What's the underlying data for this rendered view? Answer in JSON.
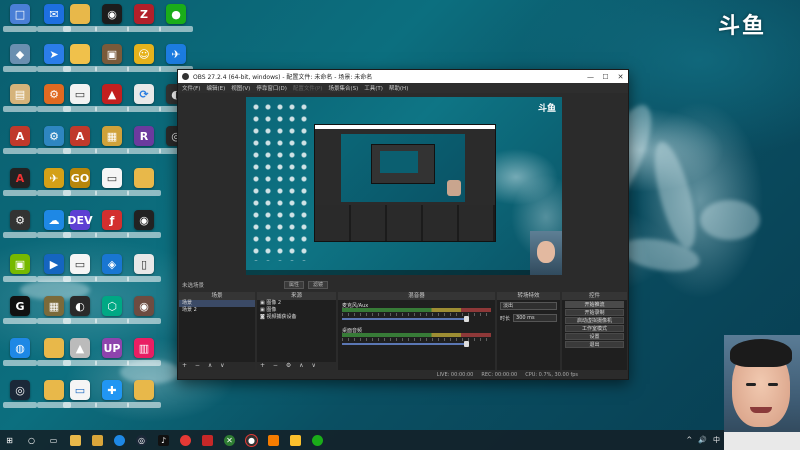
{
  "brand": {
    "logo_text": "斗鱼"
  },
  "obs": {
    "title": "OBS 27.2.4 (64-bit, windows) - 配置文件: 未命名 - 场景: 未命名",
    "window_controls": [
      "—",
      "☐",
      "✕"
    ],
    "menu": [
      "文件(F)",
      "编辑(E)",
      "视图(V)",
      "停靠窗口(D)",
      "配置文件(P)",
      "场景集合(S)",
      "工具(T)",
      "帮助(H)"
    ],
    "scene_bar": {
      "label": "未选场景",
      "btn_props": "属性",
      "btn_filters": "滤镜"
    },
    "docks": {
      "scenes": {
        "header": "场景",
        "items": [
          "场景",
          "场景 2"
        ],
        "footer": "+ − ∧ ∨"
      },
      "sources": {
        "header": "来源",
        "items": [
          "图像 2",
          "图像",
          "视频捕获设备"
        ],
        "footer": "+ − ⚙ ∧ ∨"
      },
      "mixer": {
        "header": "混音器",
        "channels": [
          {
            "name": "麦克风/Aux",
            "db": "0.0 dB"
          },
          {
            "name": "桌面音频",
            "db": "0.0 dB"
          }
        ]
      },
      "transitions": {
        "header": "转场特效",
        "type": "淡出",
        "duration_label": "时长",
        "duration": "300 ms"
      },
      "controls": {
        "header": "控件",
        "buttons": [
          "开始推流",
          "开始录制",
          "启动虚拟摄像机",
          "工作室模式",
          "设置",
          "退出"
        ]
      }
    },
    "status": {
      "live": "LIVE: 00:00:00",
      "rec": "REC: 00:00:00",
      "cpu": "CPU: 0.7%, 30.00 fps"
    }
  },
  "taskbar": {
    "tray_time": "",
    "tray_icons": [
      "^",
      "🔊",
      "中"
    ]
  },
  "colors": {
    "obs_bg": "#2b2b2b",
    "obs_dock": "#1f1f1f",
    "accent_select": "#3b4a66",
    "ocean": "#0a5d6e"
  }
}
